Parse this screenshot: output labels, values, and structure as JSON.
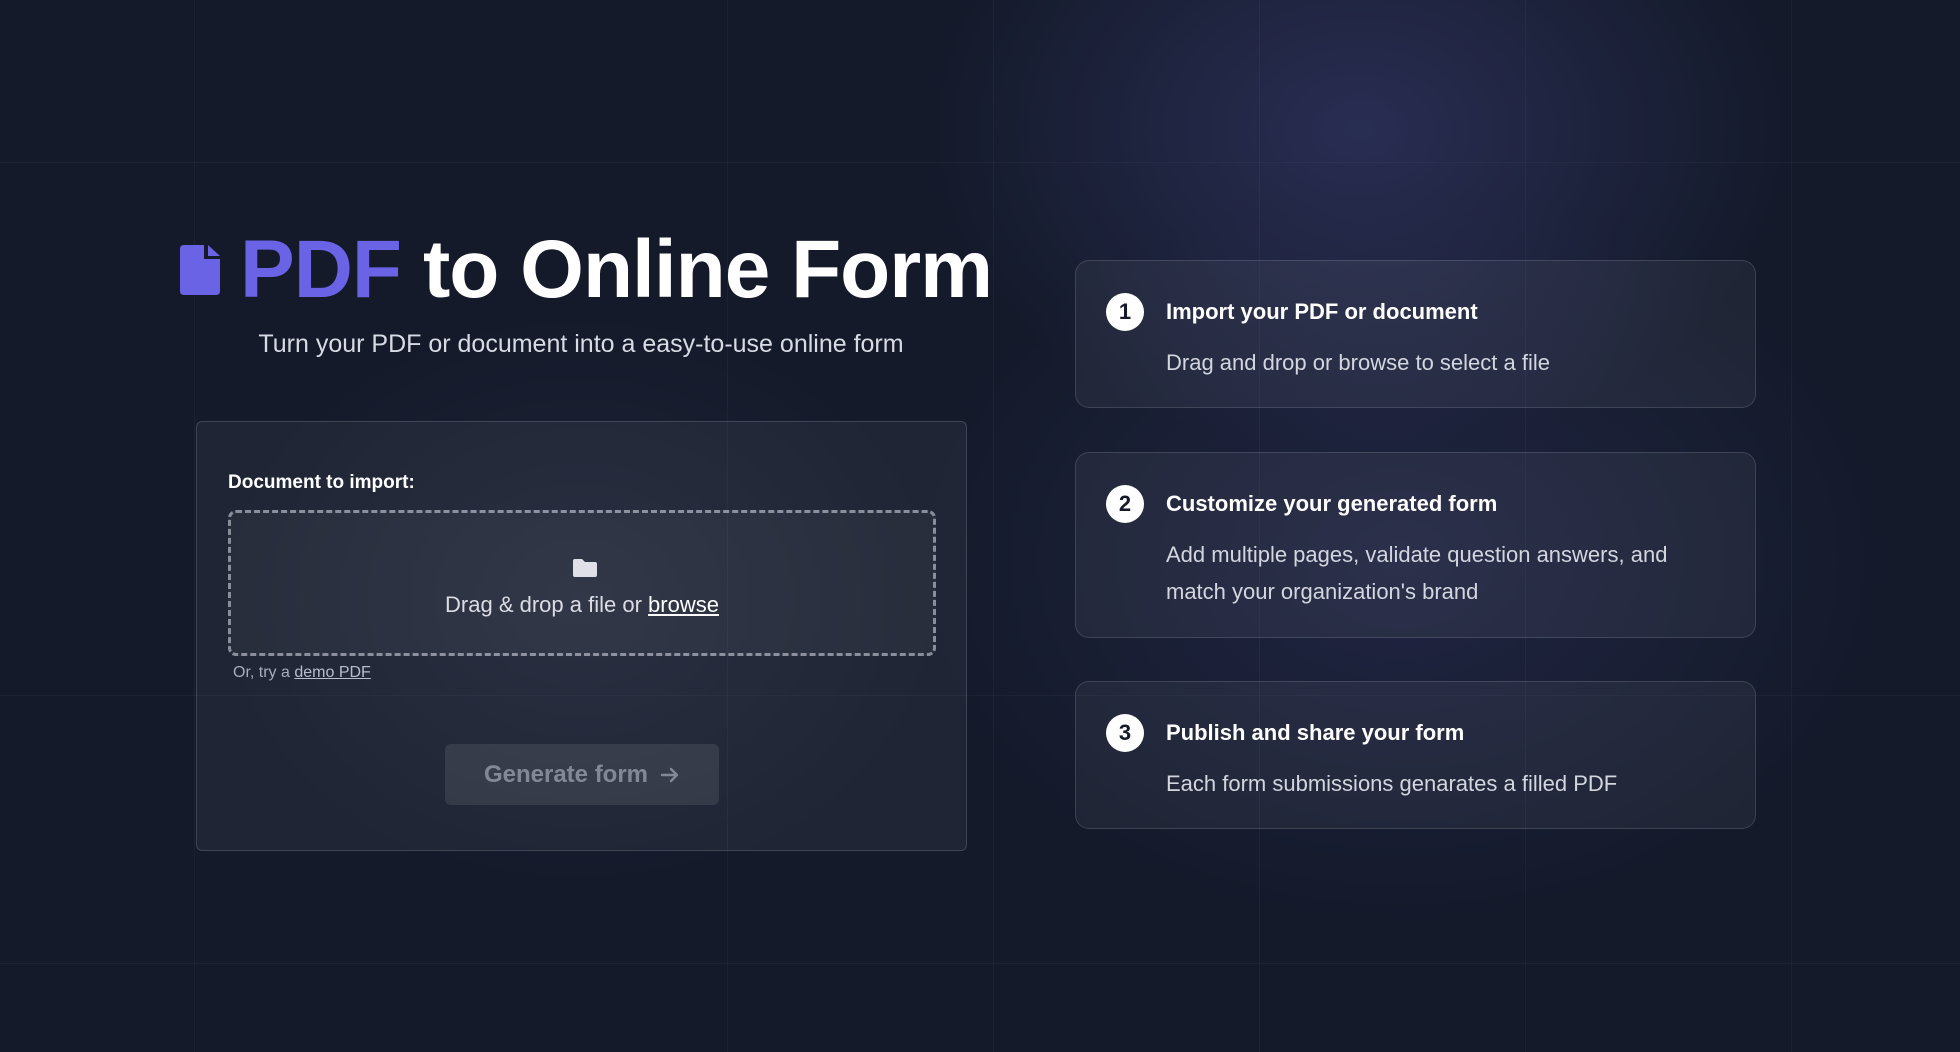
{
  "hero": {
    "title_accent": "PDF",
    "title_rest": "to Online Form",
    "subtitle": "Turn your PDF or document into a easy-to-use online form",
    "icon": "document-icon",
    "accent_color": "#6a63e6"
  },
  "import_panel": {
    "label": "Document to import:",
    "dropzone": {
      "icon": "folder-icon",
      "text": "Drag & drop a file or",
      "browse_label": "browse"
    },
    "demo_prefix": "Or, try a",
    "demo_link": "demo PDF",
    "generate_button": {
      "label": "Generate form",
      "icon": "arrow-right-icon",
      "state": "disabled"
    }
  },
  "steps": [
    {
      "number": "1",
      "title": "Import your PDF or document",
      "description": "Drag and drop or browse to select a file"
    },
    {
      "number": "2",
      "title": "Customize your generated form",
      "description": "Add multiple pages, validate question answers, and match your organization's brand"
    },
    {
      "number": "3",
      "title": "Publish and share your form",
      "description": "Each form submissions genarates a filled PDF"
    }
  ]
}
